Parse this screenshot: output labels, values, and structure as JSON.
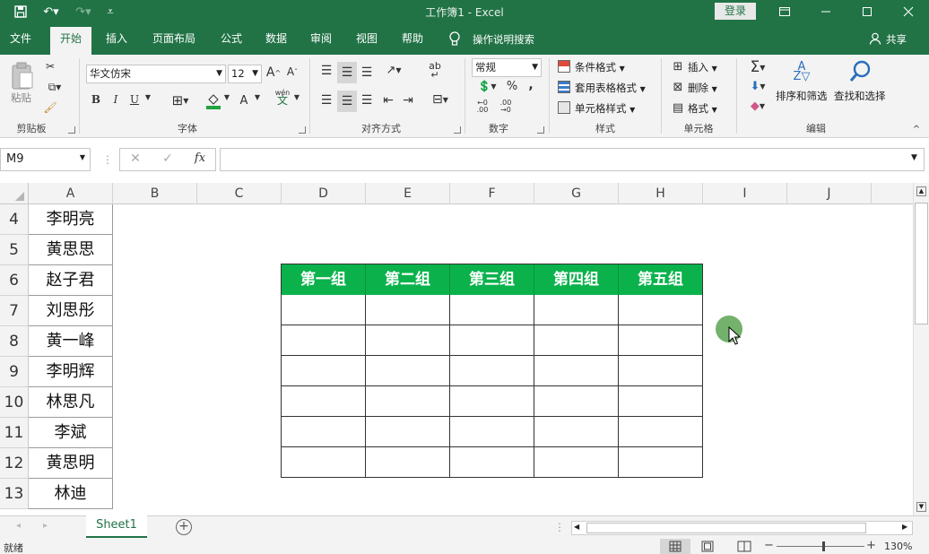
{
  "app": {
    "title": "工作簿1  -  Excel",
    "login_label": "登录",
    "share_label": "共享",
    "tell_me": "操作说明搜索"
  },
  "tabs": [
    "文件",
    "开始",
    "插入",
    "页面布局",
    "公式",
    "数据",
    "审阅",
    "视图",
    "帮助"
  ],
  "ribbon": {
    "clipboard": {
      "paste": "粘贴",
      "label": "剪贴板"
    },
    "font": {
      "name": "华文仿宋",
      "size": "12",
      "label": "字体",
      "bold": "B",
      "italic": "I",
      "underline": "U",
      "font_color_glyph": "A",
      "wen": "wén"
    },
    "alignment": {
      "label": "对齐方式"
    },
    "number": {
      "format": "常规",
      "label": "数字",
      "percent": "%",
      "comma": ","
    },
    "styles": {
      "conditional": "条件格式",
      "table_format": "套用表格格式",
      "cell_styles": "单元格样式",
      "label": "样式"
    },
    "cells": {
      "insert": "插入",
      "delete": "删除",
      "format": "格式",
      "label": "单元格"
    },
    "editing": {
      "sort_filter": "排序和筛选",
      "find_select": "查找和选择",
      "label": "编辑"
    }
  },
  "formula_bar": {
    "name_box": "M9",
    "fx": "fx",
    "formula": ""
  },
  "columns": [
    "A",
    "B",
    "C",
    "D",
    "E",
    "F",
    "G",
    "H",
    "I",
    "J"
  ],
  "rows": [
    "4",
    "5",
    "6",
    "7",
    "8",
    "9",
    "10",
    "11",
    "12",
    "13"
  ],
  "names": [
    "李明亮",
    "黄思思",
    "赵子君",
    "刘思彤",
    "黄一峰",
    "李明辉",
    "林思凡",
    "李斌",
    "黄思明",
    "林迪"
  ],
  "group_headers": [
    "第一组",
    "第二组",
    "第三组",
    "第四组",
    "第五组"
  ],
  "sheets": {
    "active": "Sheet1"
  },
  "status": {
    "ready": "就绪",
    "zoom": "130%"
  },
  "colors": {
    "excel_green": "#217346",
    "header_green": "#0bb24c",
    "cursor_highlight": "#5aa352"
  }
}
